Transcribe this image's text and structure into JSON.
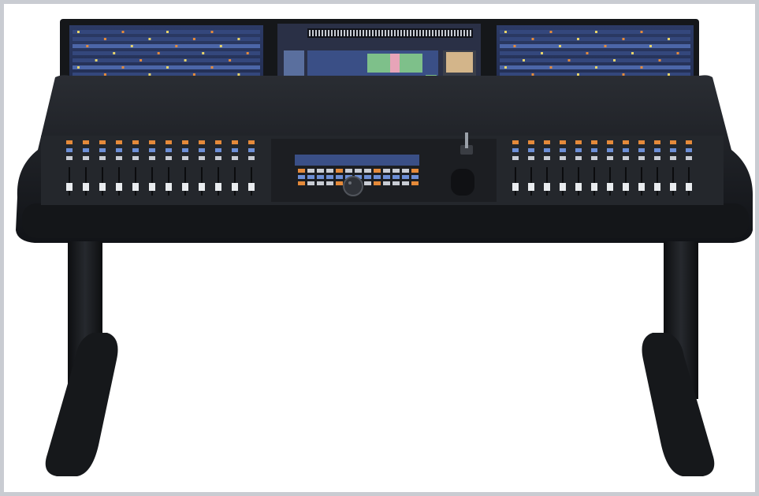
{
  "image": {
    "subject": "mixing-console",
    "colors": {
      "background": "#ffffff",
      "frame": "#c9ccd2",
      "console_body": "#1d1f23",
      "console_edge": "#2b2e34",
      "screen_bg": "#1f2a4a",
      "screen_accent": "#6aa0e6",
      "waveform_green": "#7ec08a",
      "waveform_pink": "#e7a4b8",
      "button_orange": "#e58a3a",
      "button_blue": "#6d8fd6",
      "fader_cap": "#e9ecef",
      "stand": "#16181b"
    },
    "channel_strips": {
      "left_bay": 12,
      "right_bay": 12
    }
  }
}
